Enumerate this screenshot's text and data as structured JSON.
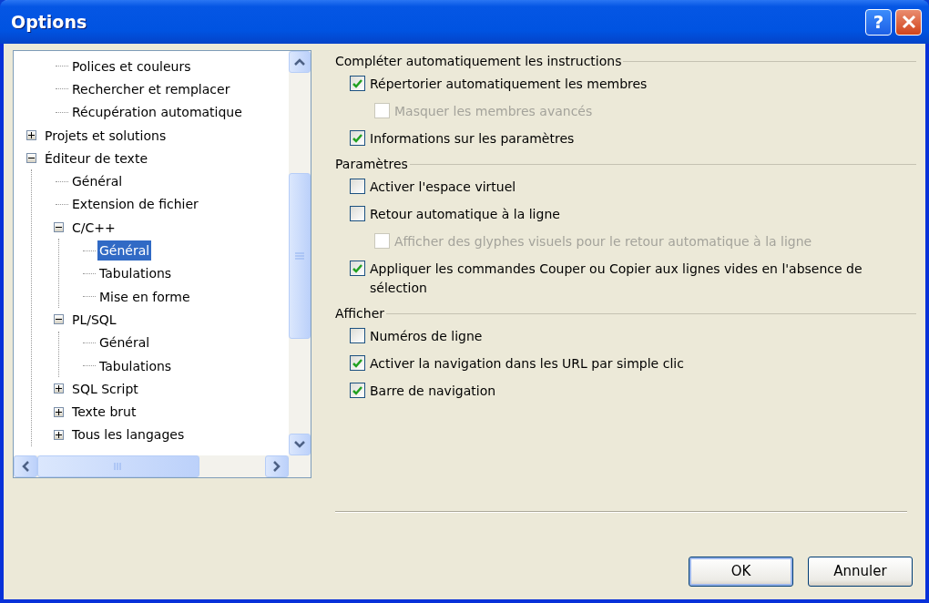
{
  "window": {
    "title": "Options",
    "help_button": "?"
  },
  "tree": {
    "items": [
      {
        "children": [
          {
            "label": "Polices et couleurs",
            "selected": false
          },
          {
            "label": "Rechercher et remplacer",
            "selected": false
          },
          {
            "label": "Récupération automatique",
            "selected": false
          }
        ]
      },
      {
        "label": "Projets et solutions",
        "selected": false,
        "expanded": false
      },
      {
        "label": "Éditeur de texte",
        "selected": false,
        "expanded": true,
        "children": [
          {
            "label": "Général",
            "selected": false
          },
          {
            "label": "Extension de fichier",
            "selected": false
          },
          {
            "label": "C/C++",
            "selected": false,
            "expanded": true,
            "children": [
              {
                "label": "Général",
                "selected": true
              },
              {
                "label": "Tabulations",
                "selected": false
              },
              {
                "label": "Mise en forme",
                "selected": false
              }
            ]
          },
          {
            "label": "PL/SQL",
            "selected": false,
            "expanded": true,
            "children": [
              {
                "label": "Général",
                "selected": false
              },
              {
                "label": "Tabulations",
                "selected": false
              }
            ]
          },
          {
            "label": "SQL Script",
            "selected": false,
            "expanded": false
          },
          {
            "label": "Texte brut",
            "selected": false,
            "expanded": false
          },
          {
            "label": "Tous les langages",
            "selected": false,
            "expanded": false
          }
        ]
      }
    ]
  },
  "sections": [
    {
      "title": "Compléter automatiquement les instructions",
      "options": [
        {
          "label": "Répertorier automatiquement les membres",
          "checked": true,
          "disabled": false,
          "children": [
            {
              "label": "Masquer les membres avancés",
              "checked": false,
              "disabled": true
            }
          ]
        },
        {
          "label": "Informations sur les paramètres",
          "checked": true,
          "disabled": false
        }
      ]
    },
    {
      "title": "Paramètres",
      "options": [
        {
          "label": "Activer l'espace virtuel",
          "checked": false,
          "disabled": false
        },
        {
          "label": "Retour automatique à la ligne",
          "checked": false,
          "disabled": false,
          "children": [
            {
              "label": "Afficher des glyphes visuels pour le retour automatique à la ligne",
              "checked": false,
              "disabled": true
            }
          ]
        },
        {
          "label": "Appliquer les commandes Couper ou Copier aux lignes vides en l'absence de sélection",
          "checked": true,
          "disabled": false
        }
      ]
    },
    {
      "title": "Afficher",
      "options": [
        {
          "label": "Numéros de ligne",
          "checked": false,
          "disabled": false
        },
        {
          "label": "Activer la navigation dans les URL par simple clic",
          "checked": true,
          "disabled": false
        },
        {
          "label": "Barre de navigation",
          "checked": true,
          "disabled": false
        }
      ]
    }
  ],
  "buttons": [
    "OK",
    "Annuler"
  ]
}
